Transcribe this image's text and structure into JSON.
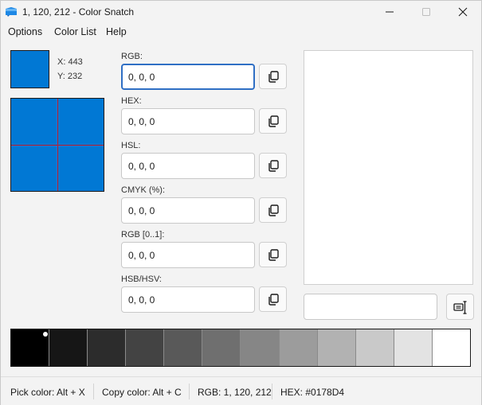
{
  "window": {
    "title": "1, 120, 212 - Color Snatch",
    "accent": "#2F6FC4"
  },
  "menu": {
    "items": [
      "Options",
      "Color List",
      "Help"
    ]
  },
  "picker": {
    "color": "#0178D4",
    "x_label": "X: 443",
    "y_label": "Y: 232",
    "crosshair_color": "#C21E2E"
  },
  "fields": [
    {
      "label": "RGB:",
      "value": "0, 0, 0"
    },
    {
      "label": "HEX:",
      "value": "0, 0, 0"
    },
    {
      "label": "HSL:",
      "value": "0, 0, 0"
    },
    {
      "label": "CMYK (%):",
      "value": "0, 0, 0"
    },
    {
      "label": "RGB [0..1]:",
      "value": "0, 0, 0"
    },
    {
      "label": "HSB/HSV:",
      "value": "0, 0, 0"
    }
  ],
  "color_name": {
    "value": ""
  },
  "shades": [
    "#000000",
    "#161616",
    "#2c2c2c",
    "#434343",
    "#595959",
    "#6f6f6f",
    "#868686",
    "#9c9c9c",
    "#b2b2b2",
    "#c9c9c9",
    "#e3e3e3",
    "#ffffff"
  ],
  "status": {
    "pick": "Pick color: Alt + X",
    "copy": "Copy color: Alt + C",
    "rgb": "RGB: 1, 120, 212",
    "hex": "HEX: #0178D4"
  }
}
